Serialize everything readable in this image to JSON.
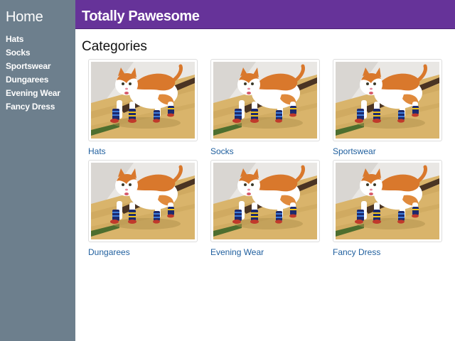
{
  "sidebar": {
    "home_label": "Home",
    "items": [
      {
        "label": "Hats"
      },
      {
        "label": "Socks"
      },
      {
        "label": "Sportswear"
      },
      {
        "label": "Dungarees"
      },
      {
        "label": "Evening Wear"
      },
      {
        "label": "Fancy Dress"
      }
    ]
  },
  "header": {
    "title": "Totally Pawesome"
  },
  "main": {
    "heading": "Categories",
    "categories": [
      {
        "label": "Hats",
        "image_icon": "cat-in-socks-photo"
      },
      {
        "label": "Socks",
        "image_icon": "cat-in-socks-photo"
      },
      {
        "label": "Sportswear",
        "image_icon": "cat-in-socks-photo"
      },
      {
        "label": "Dungarees",
        "image_icon": "cat-in-socks-photo"
      },
      {
        "label": "Evening Wear",
        "image_icon": "cat-in-socks-photo"
      },
      {
        "label": "Fancy Dress",
        "image_icon": "cat-in-socks-photo"
      }
    ]
  },
  "colors": {
    "sidebar_bg": "#6d7f8d",
    "header_bg": "#663399",
    "link": "#1f5f9e"
  }
}
